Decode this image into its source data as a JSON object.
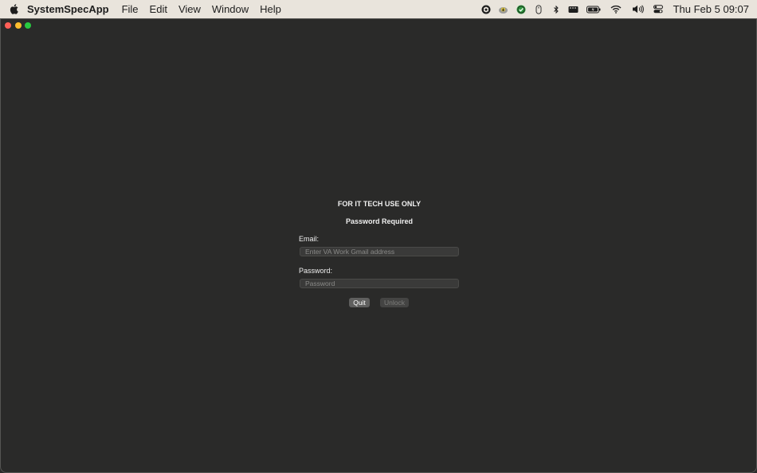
{
  "menubar": {
    "apple_icon": "apple-logo-icon",
    "app_name": "SystemSpecApp",
    "items": [
      {
        "label": "File"
      },
      {
        "label": "Edit"
      },
      {
        "label": "View"
      },
      {
        "label": "Window"
      },
      {
        "label": "Help"
      }
    ],
    "tray_icons": [
      "shield-cube-icon",
      "cloud-sync-icon",
      "green-check-icon",
      "mouse-icon",
      "bluetooth-icon",
      "display-icon",
      "battery-charging-icon",
      "wifi-icon",
      "volume-icon",
      "control-center-icon"
    ],
    "clock": "Thu Feb 5  09:07"
  },
  "window": {
    "controls": {
      "close_color": "#ff5f57",
      "minimize_color": "#febc2e",
      "zoom_color": "#28c840"
    },
    "notice": "FOR IT TECH USE ONLY",
    "heading": "Password Required",
    "email": {
      "label": "Email:",
      "placeholder": "Enter VA Work Gmail address",
      "value": ""
    },
    "password": {
      "label": "Password:",
      "placeholder": "Password",
      "value": ""
    },
    "buttons": {
      "quit": "Quit",
      "unlock": "Unlock"
    }
  },
  "colors": {
    "window_background": "#2a2a29",
    "menubar_background": "#e9e4dc",
    "text_primary": "#f0f0f0"
  }
}
